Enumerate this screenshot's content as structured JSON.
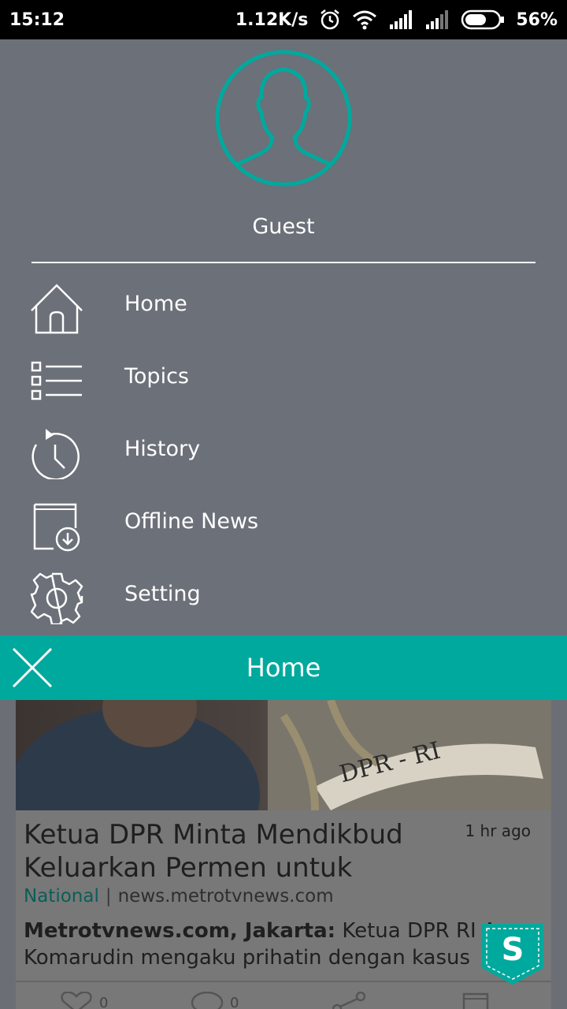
{
  "status_bar": {
    "time": "15:12",
    "speed": "1.12K/s",
    "battery": "56%",
    "icons": [
      "alarm-icon",
      "wifi-icon",
      "signal-icon",
      "signal-icon",
      "battery-icon"
    ]
  },
  "drawer": {
    "user_name": "Guest",
    "items": [
      {
        "label": "Home",
        "icon": "home-icon"
      },
      {
        "label": "Topics",
        "icon": "list-icon"
      },
      {
        "label": "History",
        "icon": "history-icon"
      },
      {
        "label": "Offline News",
        "icon": "offline-news-icon"
      },
      {
        "label": "Setting",
        "icon": "gear-icon"
      }
    ]
  },
  "header": {
    "title": "Home"
  },
  "article": {
    "image_text": "DPR - RI",
    "headline": "Ketua DPR Minta Mendikbud Keluarkan Permen untuk",
    "time_ago": "1 hr ago",
    "category": "National",
    "source": "news.metrotvnews.com",
    "snippet_source": "Metrotvnews.com, Jakarta:",
    "snippet_text": "Ketua DPR RI Ad",
    "snippet_line2": "Komarudin mengaku prihatin dengan kasus",
    "like_count": "0",
    "comment_count": "0"
  },
  "colors": {
    "teal": "#00a99d",
    "drawer_bg": "#6b7079"
  }
}
